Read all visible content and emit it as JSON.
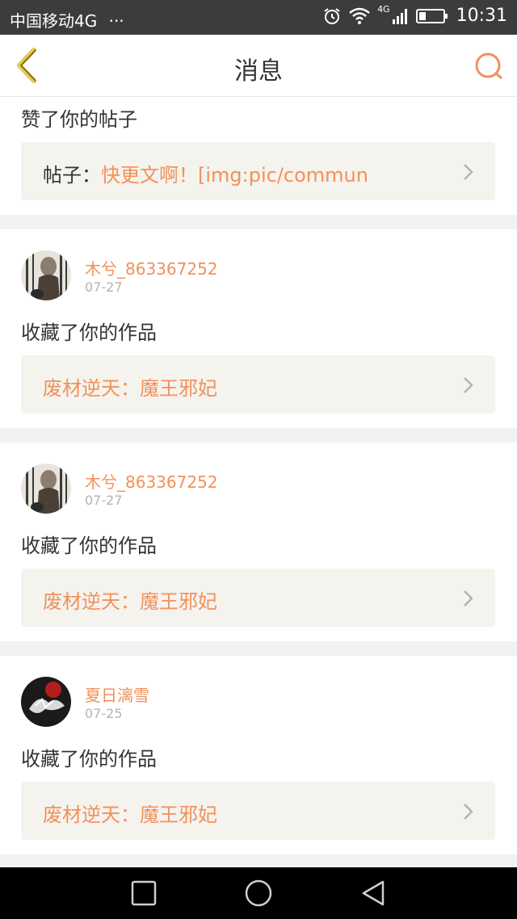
{
  "status_bar": {
    "carrier": "中国移动4G",
    "dots": "···",
    "network": "4G",
    "time": "10:31"
  },
  "header": {
    "title": "消息"
  },
  "partial_card": {
    "action": "赞了你的帖子",
    "link_prefix": "帖子：",
    "link_text": "快更文啊！[img:pic/commun"
  },
  "messages": [
    {
      "username": "木兮_863367252",
      "date": "07-27",
      "action": "收藏了你的作品",
      "link_text": "废材逆天：魔王邪妃"
    },
    {
      "username": "木兮_863367252",
      "date": "07-27",
      "action": "收藏了你的作品",
      "link_text": "废材逆天：魔王邪妃"
    },
    {
      "username": "夏日漓雪",
      "date": "07-25",
      "action": "收藏了你的作品",
      "link_text": "废材逆天：魔王邪妃"
    }
  ],
  "colors": {
    "accent": "#f2915a",
    "back_icon": "#e6c84d",
    "status_bar": "#3c3c3c",
    "link_bg": "#f5f3ee"
  },
  "icons": {
    "back": "chevron-left-icon",
    "search": "search-icon",
    "link_chevron": "chevron-right-icon",
    "nav_recents": "square-icon",
    "nav_home": "circle-icon",
    "nav_back": "triangle-back-icon"
  }
}
